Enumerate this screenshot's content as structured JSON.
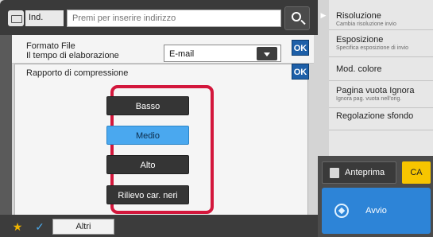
{
  "address_bar": {
    "ind_label": "Ind.",
    "placeholder": "Premi per inserire indirizzo",
    "search_icon": "search-icon"
  },
  "format": {
    "label_line1": "Formato File",
    "label_line2": "Il tempo di elaborazione",
    "selected_value": "E-mail",
    "ok_label": "OK"
  },
  "compression": {
    "title": "Rapporto di compressione",
    "ok_label": "OK",
    "options": [
      "Basso",
      "Medio",
      "Alto",
      "Rilievo car. neri"
    ],
    "selected": "Medio",
    "highlight_color": "#d3173c",
    "selected_color": "#4aa8ef"
  },
  "right_menu": {
    "items": [
      {
        "title": "Risoluzione",
        "subtitle": "Cambia risoluzione invio"
      },
      {
        "title": "Esposizione",
        "subtitle": "Specifica esposizione di invio"
      },
      {
        "title": "Mod. colore",
        "subtitle": ""
      },
      {
        "title": "Pagina vuota Ignora",
        "subtitle": "Ignora pag. vuota nell'orig."
      },
      {
        "title": "Regolazione sfondo",
        "subtitle": ""
      }
    ]
  },
  "actions": {
    "preview_label": "Anteprima",
    "ca_label": "CA",
    "start_label": "Avvio",
    "start_color": "#2d84d7",
    "ca_color": "#f7c500"
  },
  "bottom": {
    "altri_label": "Altri"
  }
}
